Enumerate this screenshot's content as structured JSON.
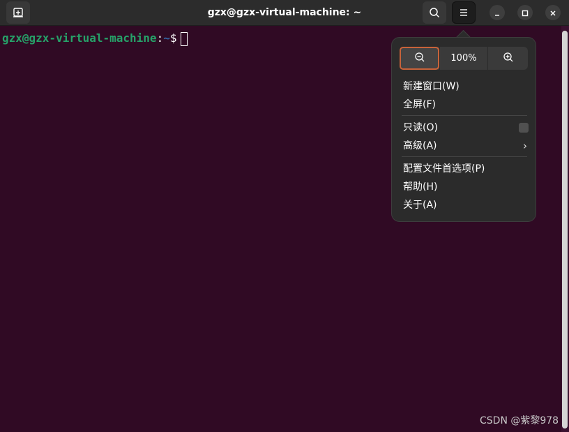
{
  "window": {
    "title": "gzx@gzx-virtual-machine: ~",
    "icons": {
      "new_tab": "new-tab-icon",
      "search": "search-icon",
      "menu": "hamburger-menu-icon",
      "minimize": "minimize-icon",
      "maximize": "maximize-icon",
      "close": "close-icon"
    }
  },
  "terminal": {
    "user_host": "gzx@gzx-virtual-machine",
    "colon": ":",
    "path": "~",
    "dollar": "$",
    "colors": {
      "background": "#300a24",
      "user": "#26a269",
      "path": "#3465a4"
    }
  },
  "menu": {
    "zoom_out_icon": "zoom-out-icon",
    "zoom_level": "100%",
    "zoom_in_icon": "zoom-in-icon",
    "items": [
      {
        "label": "新建窗口(W)"
      },
      {
        "label": "全屏(F)"
      },
      {
        "label": "只读(O)",
        "checkbox": false
      },
      {
        "label": "高级(A)",
        "submenu": true
      },
      {
        "label": "配置文件首选项(P)"
      },
      {
        "label": "帮助(H)"
      },
      {
        "label": "关于(A)"
      }
    ],
    "accent": "#c8633a"
  },
  "watermark": "CSDN @紫黎978"
}
